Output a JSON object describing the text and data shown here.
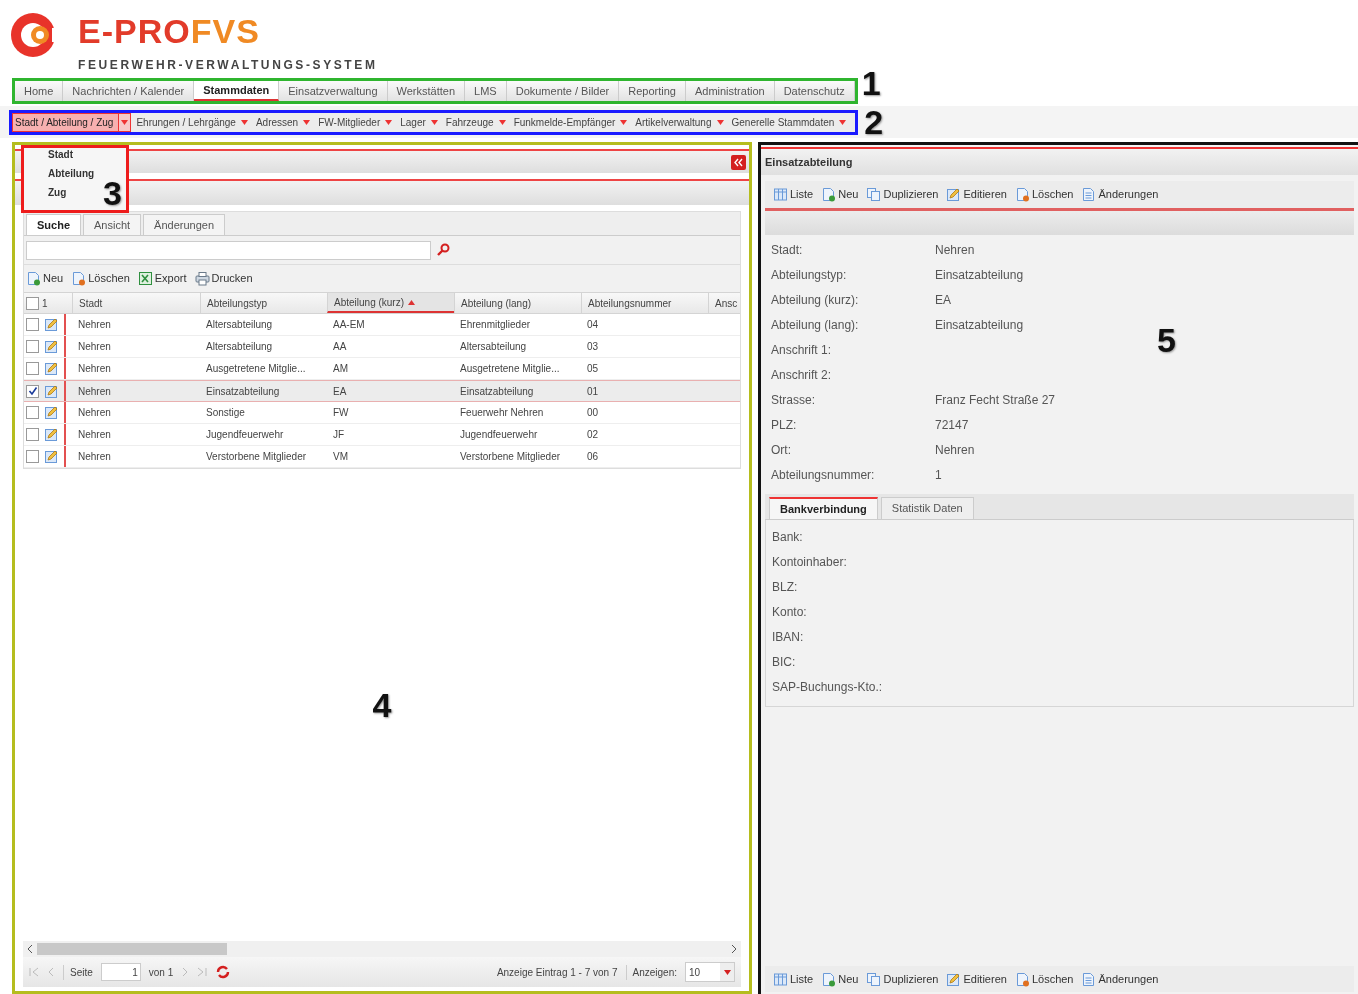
{
  "logo": {
    "title_a": "E-PRO",
    "title_b": "FVS",
    "subtitle": "FEUERWEHR-VERWALTUNGS-SYSTEM"
  },
  "main_nav": {
    "annotation": {
      "label": "1",
      "color": "#2fb52f"
    },
    "items": [
      {
        "label": "Home",
        "selected": false
      },
      {
        "label": "Nachrichten / Kalender",
        "selected": false
      },
      {
        "label": "Stammdaten",
        "selected": true
      },
      {
        "label": "Einsatzverwaltung",
        "selected": false
      },
      {
        "label": "Werkstätten",
        "selected": false
      },
      {
        "label": "LMS",
        "selected": false
      },
      {
        "label": "Dokumente / Bilder",
        "selected": false
      },
      {
        "label": "Reporting",
        "selected": false
      },
      {
        "label": "Administration",
        "selected": false
      },
      {
        "label": "Datenschutz",
        "selected": false
      }
    ]
  },
  "sub_nav": {
    "annotation": {
      "label": "2",
      "color": "#1a1aff"
    },
    "items": [
      {
        "label": "Stadt / Abteilung / Zug",
        "selected": true
      },
      {
        "label": "Ehrungen / Lehrgänge",
        "selected": false
      },
      {
        "label": "Adressen",
        "selected": false
      },
      {
        "label": "FW-Mitglieder",
        "selected": false
      },
      {
        "label": "Lager",
        "selected": false
      },
      {
        "label": "Fahrzeuge",
        "selected": false
      },
      {
        "label": "Funkmelde-Empfänger",
        "selected": false
      },
      {
        "label": "Artikelverwaltung",
        "selected": false
      },
      {
        "label": "Generelle Stammdaten",
        "selected": false
      }
    ]
  },
  "dropdown_menu": {
    "annotation": {
      "label": "3",
      "color": "#ee1c1c"
    },
    "items": [
      "Stadt",
      "Abteilung",
      "Zug"
    ]
  },
  "list_panel": {
    "annotation": {
      "label": "4",
      "color": "#b5bd1e"
    },
    "tabs": [
      {
        "label": "Suche",
        "selected": true
      },
      {
        "label": "Ansicht",
        "selected": false
      },
      {
        "label": "Änderungen",
        "selected": false
      }
    ],
    "toolbar": [
      {
        "kind": "new",
        "label": "Neu"
      },
      {
        "kind": "delete",
        "label": "Löschen"
      },
      {
        "kind": "export",
        "label": "Export"
      },
      {
        "kind": "print",
        "label": "Drucken"
      }
    ],
    "grid": {
      "header_count": "1",
      "header_checked": false,
      "columns": [
        {
          "label": "Stadt",
          "sorted": false
        },
        {
          "label": "Abteilungstyp",
          "sorted": false
        },
        {
          "label": "Abteilung (kurz)",
          "sorted": true
        },
        {
          "label": "Abteilung (lang)",
          "sorted": false
        },
        {
          "label": "Abteilungsnummer",
          "sorted": false
        },
        {
          "label": "Ansc",
          "sorted": false
        }
      ],
      "rows": [
        {
          "checked": false,
          "selected": false,
          "cells": [
            "Nehren",
            "Altersabteilung",
            "AA-EM",
            "Ehrenmitglieder",
            "04"
          ]
        },
        {
          "checked": false,
          "selected": false,
          "cells": [
            "Nehren",
            "Altersabteilung",
            "AA",
            "Altersabteilung",
            "03"
          ]
        },
        {
          "checked": false,
          "selected": false,
          "cells": [
            "Nehren",
            "Ausgetretene Mitglie...",
            "AM",
            "Ausgetretene Mitglie...",
            "05"
          ]
        },
        {
          "checked": true,
          "selected": true,
          "cells": [
            "Nehren",
            "Einsatzabteilung",
            "EA",
            "Einsatzabteilung",
            "01"
          ]
        },
        {
          "checked": false,
          "selected": false,
          "cells": [
            "Nehren",
            "Sonstige",
            "FW",
            "Feuerwehr Nehren",
            "00"
          ]
        },
        {
          "checked": false,
          "selected": false,
          "cells": [
            "Nehren",
            "Jugendfeuerwehr",
            "JF",
            "Jugendfeuerwehr",
            "02"
          ]
        },
        {
          "checked": false,
          "selected": false,
          "cells": [
            "Nehren",
            "Verstorbene Mitglieder",
            "VM",
            "Verstorbene Mitglieder",
            "06"
          ]
        }
      ]
    },
    "pager": {
      "page_label": "Seite",
      "page": "1",
      "of": "von 1",
      "info": "Anzeige Eintrag 1 - 7 von 7",
      "size_label": "Anzeigen:",
      "size": "10"
    }
  },
  "detail_panel": {
    "annotation": {
      "label": "5",
      "color": "#111111"
    },
    "title": "Einsatzabteilung",
    "toolbar": [
      {
        "kind": "list",
        "label": "Liste"
      },
      {
        "kind": "new",
        "label": "Neu"
      },
      {
        "kind": "copy",
        "label": "Duplizieren"
      },
      {
        "kind": "edit",
        "label": "Editieren"
      },
      {
        "kind": "delete",
        "label": "Löschen"
      },
      {
        "kind": "changes",
        "label": "Änderungen"
      }
    ],
    "fields": [
      {
        "label": "Stadt:",
        "value": "Nehren"
      },
      {
        "label": "Abteilungstyp:",
        "value": "Einsatzabteilung"
      },
      {
        "label": "Abteilung (kurz):",
        "value": "EA"
      },
      {
        "label": "Abteilung (lang):",
        "value": "Einsatzabteilung"
      },
      {
        "label": "Anschrift 1:"
      },
      {
        "label": "Anschrift 2:"
      },
      {
        "label": "Strasse:",
        "value": "Franz Fecht Straße 27"
      },
      {
        "label": "PLZ:",
        "value": "72147"
      },
      {
        "label": "Ort:",
        "value": "Nehren"
      },
      {
        "label": "Abteilungsnummer:",
        "value": "1"
      }
    ],
    "tabs": [
      {
        "label": "Bankverbindung",
        "selected": true
      },
      {
        "label": "Statistik Daten",
        "selected": false
      }
    ],
    "bank_fields": [
      "Bank:",
      "Kontoinhaber:",
      "BLZ:",
      "Konto:",
      "IBAN:",
      "BIC:",
      "SAP-Buchungs-Kto.:"
    ],
    "bottom_toolbar": [
      {
        "kind": "list",
        "label": "Liste"
      },
      {
        "kind": "new",
        "label": "Neu"
      },
      {
        "kind": "copy",
        "label": "Duplizieren"
      },
      {
        "kind": "edit",
        "label": "Editieren"
      },
      {
        "kind": "delete",
        "label": "Löschen"
      },
      {
        "kind": "changes",
        "label": "Änderungen"
      }
    ]
  }
}
